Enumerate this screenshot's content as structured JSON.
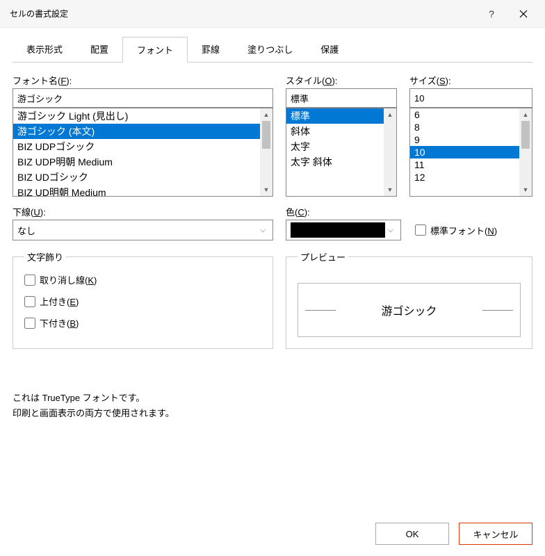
{
  "titlebar": {
    "title": "セルの書式設定"
  },
  "tabs": [
    "表示形式",
    "配置",
    "フォント",
    "罫線",
    "塗りつぶし",
    "保護"
  ],
  "activeTab": 2,
  "labels": {
    "font": "フォント名(F):",
    "style": "スタイル(O):",
    "size": "サイズ(S):",
    "underline": "下線(U):",
    "color": "色(C):",
    "normalFont": "標準フォント(N)",
    "decor": "文字飾り",
    "preview": "プレビュー",
    "strikethrough": "取り消し線(K)",
    "superscript": "上付き(E)",
    "subscript": "下付き(B)"
  },
  "font": {
    "value": "游ゴシック",
    "list": [
      "游ゴシック Light (見出し)",
      "游ゴシック (本文)",
      "BIZ UDPゴシック",
      "BIZ UDP明朝 Medium",
      "BIZ UDゴシック",
      "BIZ UD明朝 Medium"
    ],
    "selectedIndex": 1
  },
  "style": {
    "value": "標準",
    "list": [
      "標準",
      "斜体",
      "太字",
      "太字 斜体"
    ],
    "selectedIndex": 0
  },
  "size": {
    "value": "10",
    "list": [
      "6",
      "8",
      "9",
      "10",
      "11",
      "12"
    ],
    "selectedIndex": 3
  },
  "underline": {
    "value": "なし"
  },
  "color": {
    "value": "#000000"
  },
  "checkboxes": {
    "normalFont": false,
    "strikethrough": false,
    "superscript": false,
    "subscript": false
  },
  "previewText": "游ゴシック",
  "info": {
    "line1": "これは TrueType フォントです。",
    "line2": "印刷と画面表示の両方で使用されます。"
  },
  "buttons": {
    "ok": "OK",
    "cancel": "キャンセル"
  }
}
